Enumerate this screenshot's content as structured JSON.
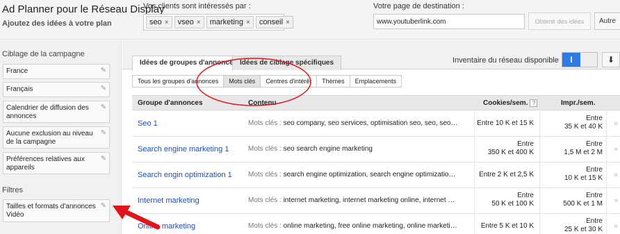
{
  "header": {
    "app_title": "Ad Planner pour le Réseau Display",
    "app_subtitle": "Ajoutez des idées à votre plan",
    "interest_label": "Vos clients sont intéressés par :",
    "interest_chips": [
      "seo",
      "vseo",
      "marketing",
      "conseil"
    ],
    "chip_remove": "×",
    "destination_label": "Votre page de destination :",
    "destination_value": "www.youtuberlink.com",
    "get_ideas_button": "Obtenir des idées",
    "other_button": "Autre"
  },
  "sidebar": {
    "campaign_title": "Ciblage de la campagne",
    "campaign_items": [
      "France",
      "Français",
      "Calendrier de diffusion des annonces",
      "Aucune exclusion au niveau de la campagne",
      "Préférences relatives aux appareils"
    ],
    "filters_title": "Filtres",
    "filter_items": [
      {
        "line1": "Tailles et formats d'annonces",
        "line2": "Vidéo"
      }
    ]
  },
  "main": {
    "tabs": [
      "Idées de groupes d'annonces",
      "Idées de ciblage spécifiques"
    ],
    "inventory_label": "Inventaire du réseau disponible :",
    "toggle_on": "I",
    "download_icon": "⬇",
    "subtabs": [
      "Tous les groupes d'annonces",
      "Mots clés",
      "Centres d'intérêt",
      "Thèmes",
      "Emplacements"
    ],
    "table": {
      "headers": {
        "group": "Groupe d'annonces",
        "content": "Contenu",
        "cookies": "Cookies/sem.",
        "help": "?",
        "impr": "Impr./sem."
      },
      "content_prefix": "Mots clés : ",
      "rows": [
        {
          "name": "Seo 1",
          "content": "seo company, seo services, optimisation seo, seo, seo…",
          "cookies": [
            "Entre 10 K et 15 K"
          ],
          "impr": [
            "Entre",
            "35 K et 40 K"
          ]
        },
        {
          "name": "Search engine marketing 1",
          "content": "seo search engine marketing",
          "cookies": [
            "Entre",
            "350 K et 400 K"
          ],
          "impr": [
            "Entre",
            "1,5 M et 2 M"
          ]
        },
        {
          "name": "Search engin optimization 1",
          "content": "search engine optimization, search engine optimizatio…",
          "cookies": [
            "Entre 2 K et 2,5 K"
          ],
          "impr": [
            "Entre",
            "10 K et 15 K"
          ]
        },
        {
          "name": "Internet marketing",
          "content": "internet marketing, internet marketing online, internet …",
          "cookies": [
            "Entre",
            "50 K et 100 K"
          ],
          "impr": [
            "Entre",
            "500 K et 1 M"
          ]
        },
        {
          "name": "Online marketing",
          "content": "online marketing, free online marketing, online marketi…",
          "cookies": [
            "Entre 5 K et 10 K"
          ],
          "impr": [
            "Entre",
            "25 K et 30 K"
          ]
        }
      ],
      "row_arrow": "»"
    }
  },
  "colors": {
    "annotation_red": "#e0151b",
    "link_blue": "#1a4fb5",
    "toggle_blue": "#2d7be5"
  }
}
